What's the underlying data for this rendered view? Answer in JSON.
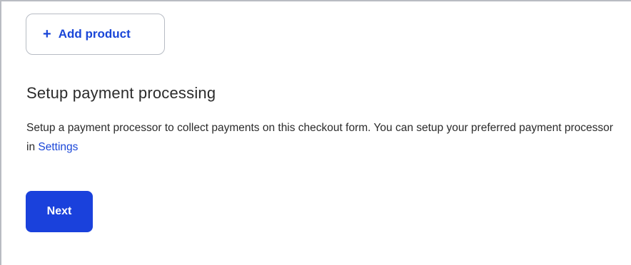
{
  "add_product": {
    "icon": "plus-icon",
    "icon_glyph": "+",
    "label": "Add product"
  },
  "payment": {
    "title": "Setup payment processing",
    "description": "Setup a payment processor to collect payments on this checkout form. You can setup your preferred payment processor in ",
    "link_text": "Settings"
  },
  "actions": {
    "next_label": "Next"
  },
  "colors": {
    "accent": "#1a46d8",
    "primary_button": "#1a41dc",
    "border": "#b7bcc4",
    "text": "#2b2b2b"
  }
}
